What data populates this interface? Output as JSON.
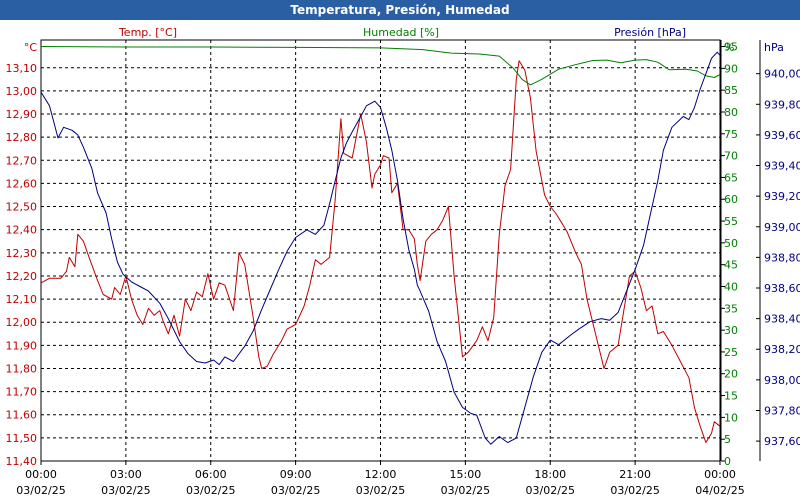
{
  "window": {
    "title": "Temperatura, Presión, Humedad"
  },
  "chart_data": {
    "type": "line",
    "title": "Temperatura, Presión, Humedad",
    "grid": true,
    "colors": {
      "temp": "#c00000",
      "hum": "#008000",
      "pres": "#000080",
      "title_bg": "#2b5fa3"
    },
    "left_axis": {
      "unit": "°C",
      "range": [
        11.4,
        13.22
      ],
      "ticks": [
        "11,40",
        "11,50",
        "11,60",
        "11,70",
        "11,80",
        "11,90",
        "12,00",
        "12,10",
        "12,20",
        "12,30",
        "12,40",
        "12,50",
        "12,60",
        "12,70",
        "12,80",
        "12,90",
        "13,00",
        "13,10"
      ]
    },
    "mid_axis": {
      "unit": "%",
      "range": [
        0,
        96.5
      ],
      "ticks": [
        "0",
        "5",
        "10",
        "15",
        "20",
        "25",
        "30",
        "35",
        "40",
        "45",
        "50",
        "55",
        "60",
        "65",
        "70",
        "75",
        "80",
        "85",
        "90",
        "95"
      ]
    },
    "right_axis": {
      "unit": "hPa",
      "range": [
        937.47,
        940.22
      ],
      "ticks": [
        "937,60",
        "937,80",
        "938,00",
        "938,20",
        "938,40",
        "938,60",
        "938,80",
        "939,00",
        "939,20",
        "939,40",
        "939,60",
        "939,80",
        "940,00"
      ]
    },
    "x_axis": {
      "range": [
        0,
        24
      ],
      "ticks": [
        {
          "time": "00:00",
          "date": "03/02/25"
        },
        {
          "time": "03:00",
          "date": "03/02/25"
        },
        {
          "time": "06:00",
          "date": "03/02/25"
        },
        {
          "time": "09:00",
          "date": "03/02/25"
        },
        {
          "time": "12:00",
          "date": "03/02/25"
        },
        {
          "time": "15:00",
          "date": "03/02/25"
        },
        {
          "time": "18:00",
          "date": "03/02/25"
        },
        {
          "time": "21:00",
          "date": "03/02/25"
        },
        {
          "time": "00:00",
          "date": "04/02/25"
        }
      ]
    },
    "series": [
      {
        "name": "Temp. [°C]",
        "key": "temp",
        "axis": "left",
        "points": [
          [
            0,
            12.17
          ],
          [
            0.3,
            12.19
          ],
          [
            0.7,
            12.19
          ],
          [
            0.9,
            12.22
          ],
          [
            1.0,
            12.28
          ],
          [
            1.2,
            12.24
          ],
          [
            1.3,
            12.38
          ],
          [
            1.5,
            12.35
          ],
          [
            1.7,
            12.28
          ],
          [
            2.0,
            12.18
          ],
          [
            2.2,
            12.12
          ],
          [
            2.5,
            12.1
          ],
          [
            2.6,
            12.15
          ],
          [
            2.8,
            12.12
          ],
          [
            3.0,
            12.2
          ],
          [
            3.2,
            12.1
          ],
          [
            3.4,
            12.03
          ],
          [
            3.6,
            11.99
          ],
          [
            3.8,
            12.06
          ],
          [
            4.0,
            12.03
          ],
          [
            4.2,
            12.05
          ],
          [
            4.3,
            12.01
          ],
          [
            4.5,
            11.95
          ],
          [
            4.7,
            12.03
          ],
          [
            4.9,
            11.94
          ],
          [
            5.1,
            12.1
          ],
          [
            5.3,
            12.05
          ],
          [
            5.5,
            12.13
          ],
          [
            5.7,
            12.11
          ],
          [
            5.9,
            12.21
          ],
          [
            6.1,
            12.1
          ],
          [
            6.3,
            12.17
          ],
          [
            6.5,
            12.16
          ],
          [
            6.8,
            12.05
          ],
          [
            7.0,
            12.3
          ],
          [
            7.2,
            12.25
          ],
          [
            7.5,
            12.02
          ],
          [
            7.7,
            11.85
          ],
          [
            7.8,
            11.8
          ],
          [
            8.0,
            11.81
          ],
          [
            8.2,
            11.86
          ],
          [
            8.5,
            11.92
          ],
          [
            8.7,
            11.97
          ],
          [
            9.0,
            11.99
          ],
          [
            9.3,
            12.07
          ],
          [
            9.5,
            12.16
          ],
          [
            9.7,
            12.27
          ],
          [
            9.9,
            12.25
          ],
          [
            10.2,
            12.28
          ],
          [
            10.4,
            12.53
          ],
          [
            10.6,
            12.88
          ],
          [
            10.7,
            12.73
          ],
          [
            11.0,
            12.71
          ],
          [
            11.3,
            12.9
          ],
          [
            11.5,
            12.78
          ],
          [
            11.7,
            12.58
          ],
          [
            11.8,
            12.64
          ],
          [
            12.0,
            12.68
          ],
          [
            12.1,
            12.72
          ],
          [
            12.3,
            12.71
          ],
          [
            12.4,
            12.56
          ],
          [
            12.6,
            12.6
          ],
          [
            12.8,
            12.4
          ],
          [
            13.0,
            12.4
          ],
          [
            13.2,
            12.36
          ],
          [
            13.3,
            12.25
          ],
          [
            13.4,
            12.18
          ],
          [
            13.6,
            12.35
          ],
          [
            13.8,
            12.38
          ],
          [
            14.0,
            12.4
          ],
          [
            14.2,
            12.44
          ],
          [
            14.4,
            12.5
          ],
          [
            14.6,
            12.2
          ],
          [
            14.9,
            11.85
          ],
          [
            15.1,
            11.87
          ],
          [
            15.4,
            11.92
          ],
          [
            15.6,
            11.98
          ],
          [
            15.8,
            11.92
          ],
          [
            16.0,
            12.02
          ],
          [
            16.2,
            12.38
          ],
          [
            16.4,
            12.59
          ],
          [
            16.6,
            12.66
          ],
          [
            16.8,
            13.05
          ],
          [
            16.9,
            13.13
          ],
          [
            17.1,
            13.09
          ],
          [
            17.3,
            12.97
          ],
          [
            17.5,
            12.74
          ],
          [
            17.8,
            12.55
          ],
          [
            18.0,
            12.5
          ],
          [
            18.2,
            12.47
          ],
          [
            18.4,
            12.43
          ],
          [
            18.6,
            12.39
          ],
          [
            18.9,
            12.3
          ],
          [
            19.1,
            12.25
          ],
          [
            19.3,
            12.1
          ],
          [
            19.6,
            11.95
          ],
          [
            19.9,
            11.8
          ],
          [
            20.1,
            11.87
          ],
          [
            20.4,
            11.9
          ],
          [
            20.6,
            12.05
          ],
          [
            20.8,
            12.2
          ],
          [
            21.0,
            12.22
          ],
          [
            21.2,
            12.15
          ],
          [
            21.4,
            12.05
          ],
          [
            21.6,
            12.07
          ],
          [
            21.8,
            11.95
          ],
          [
            22.0,
            11.96
          ],
          [
            22.3,
            11.9
          ],
          [
            22.6,
            11.83
          ],
          [
            22.9,
            11.76
          ],
          [
            23.1,
            11.63
          ],
          [
            23.3,
            11.55
          ],
          [
            23.5,
            11.48
          ],
          [
            23.7,
            11.52
          ],
          [
            23.8,
            11.57
          ],
          [
            24.0,
            11.55
          ]
        ]
      },
      {
        "name": "Humedad [%]",
        "key": "hum",
        "axis": "mid",
        "points": [
          [
            0,
            95.0
          ],
          [
            3,
            94.9
          ],
          [
            6,
            94.9
          ],
          [
            9,
            94.8
          ],
          [
            12,
            94.7
          ],
          [
            13.5,
            94.3
          ],
          [
            14.5,
            93.5
          ],
          [
            15.5,
            93.3
          ],
          [
            16.2,
            92.8
          ],
          [
            16.7,
            90.0
          ],
          [
            17,
            87.5
          ],
          [
            17.3,
            86.2
          ],
          [
            17.7,
            87.5
          ],
          [
            18.3,
            89.8
          ],
          [
            18.8,
            90.7
          ],
          [
            19.5,
            91.8
          ],
          [
            20,
            91.9
          ],
          [
            20.5,
            91.3
          ],
          [
            21.0,
            91.9
          ],
          [
            21.4,
            92.0
          ],
          [
            21.8,
            91.4
          ],
          [
            22.2,
            89.7
          ],
          [
            22.8,
            89.8
          ],
          [
            23.2,
            89.4
          ],
          [
            23.5,
            88.3
          ],
          [
            23.8,
            87.9
          ],
          [
            24.0,
            88.6
          ]
        ]
      },
      {
        "name": "Presión [hPa]",
        "key": "pres",
        "axis": "right",
        "points": [
          [
            0,
            939.88
          ],
          [
            0.3,
            939.79
          ],
          [
            0.6,
            939.58
          ],
          [
            0.8,
            939.65
          ],
          [
            1.1,
            939.63
          ],
          [
            1.3,
            939.6
          ],
          [
            1.5,
            939.52
          ],
          [
            1.8,
            939.38
          ],
          [
            2.0,
            939.22
          ],
          [
            2.3,
            939.09
          ],
          [
            2.5,
            938.92
          ],
          [
            2.7,
            938.77
          ],
          [
            2.9,
            938.69
          ],
          [
            3.2,
            938.64
          ],
          [
            3.5,
            938.61
          ],
          [
            3.8,
            938.58
          ],
          [
            4.2,
            938.5
          ],
          [
            4.5,
            938.4
          ],
          [
            4.9,
            938.25
          ],
          [
            5.2,
            938.17
          ],
          [
            5.5,
            938.12
          ],
          [
            5.8,
            938.11
          ],
          [
            6.1,
            938.13
          ],
          [
            6.3,
            938.1
          ],
          [
            6.5,
            938.15
          ],
          [
            6.8,
            938.12
          ],
          [
            7.2,
            938.22
          ],
          [
            7.5,
            938.32
          ],
          [
            7.8,
            938.46
          ],
          [
            8.1,
            938.59
          ],
          [
            8.4,
            938.72
          ],
          [
            8.7,
            938.84
          ],
          [
            9.0,
            938.93
          ],
          [
            9.4,
            938.98
          ],
          [
            9.7,
            938.95
          ],
          [
            10.0,
            939.01
          ],
          [
            10.2,
            939.15
          ],
          [
            10.4,
            939.3
          ],
          [
            10.6,
            939.45
          ],
          [
            10.8,
            939.55
          ],
          [
            11.0,
            939.62
          ],
          [
            11.3,
            939.72
          ],
          [
            11.5,
            939.79
          ],
          [
            11.8,
            939.82
          ],
          [
            12.0,
            939.78
          ],
          [
            12.2,
            939.65
          ],
          [
            12.4,
            939.5
          ],
          [
            12.6,
            939.3
          ],
          [
            12.8,
            939.05
          ],
          [
            13.0,
            938.85
          ],
          [
            13.2,
            938.72
          ],
          [
            13.3,
            938.62
          ],
          [
            13.4,
            938.58
          ],
          [
            13.7,
            938.45
          ],
          [
            14.0,
            938.25
          ],
          [
            14.3,
            938.12
          ],
          [
            14.6,
            937.92
          ],
          [
            14.9,
            937.82
          ],
          [
            15.2,
            937.78
          ],
          [
            15.4,
            937.77
          ],
          [
            15.7,
            937.62
          ],
          [
            15.9,
            937.58
          ],
          [
            16.2,
            937.63
          ],
          [
            16.5,
            937.59
          ],
          [
            16.8,
            937.62
          ],
          [
            17.1,
            937.82
          ],
          [
            17.4,
            938.02
          ],
          [
            17.7,
            938.18
          ],
          [
            18.0,
            938.26
          ],
          [
            18.3,
            938.23
          ],
          [
            18.7,
            938.29
          ],
          [
            19.0,
            938.33
          ],
          [
            19.4,
            938.38
          ],
          [
            19.8,
            938.4
          ],
          [
            20.1,
            938.39
          ],
          [
            20.4,
            938.44
          ],
          [
            20.7,
            938.58
          ],
          [
            21.0,
            938.72
          ],
          [
            21.3,
            938.88
          ],
          [
            21.5,
            939.05
          ],
          [
            21.8,
            939.3
          ],
          [
            22.0,
            939.5
          ],
          [
            22.3,
            939.65
          ],
          [
            22.7,
            939.72
          ],
          [
            22.9,
            939.7
          ],
          [
            23.1,
            939.78
          ],
          [
            23.3,
            939.9
          ],
          [
            23.5,
            940.0
          ],
          [
            23.7,
            940.1
          ],
          [
            23.9,
            940.14
          ],
          [
            24.0,
            940.12
          ]
        ]
      }
    ]
  }
}
